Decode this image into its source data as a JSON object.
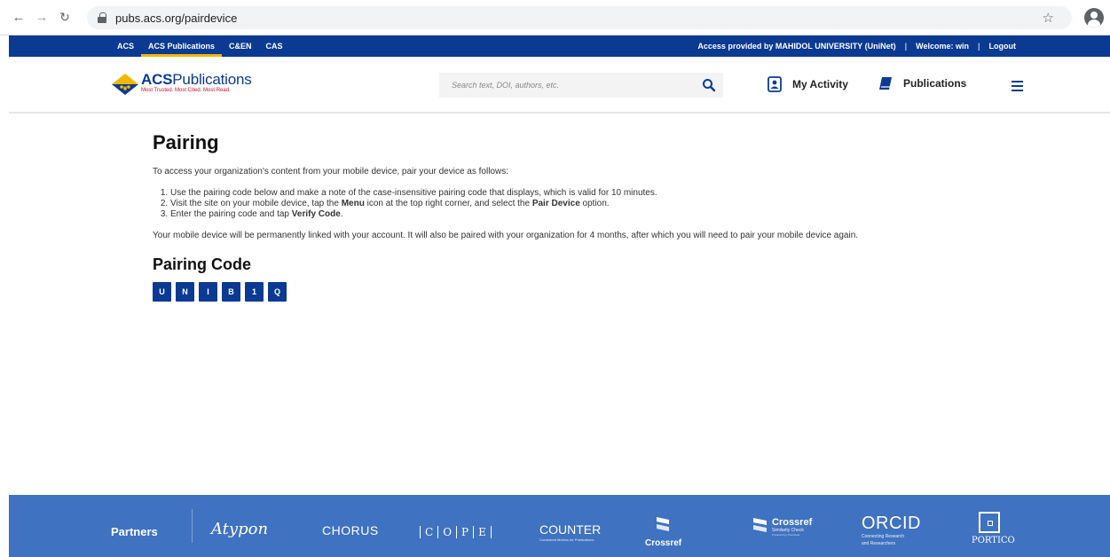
{
  "browser": {
    "url": "pubs.acs.org/pairdevice",
    "back_icon": "arrow-left-icon",
    "forward_icon": "arrow-right-icon",
    "reload_icon": "reload-icon"
  },
  "utility_bar": {
    "links": [
      "ACS",
      "ACS Publications",
      "C&EN",
      "CAS"
    ],
    "active_link": "ACS Publications",
    "access_text": "Access provided by MAHIDOL UNIVERSITY (UniNet)",
    "welcome_text": "Welcome: win",
    "logout_label": "Logout"
  },
  "header": {
    "logo_name_bold": "ACS",
    "logo_name_rest": "Publications",
    "logo_tagline": "Most Trusted. Most Cited. Most Read.",
    "search_placeholder": "Search text, DOI, authors, etc.",
    "my_activity_label": "My Activity",
    "publications_label": "Publications"
  },
  "content": {
    "title": "Pairing",
    "intro": "To access your organization's content from your mobile device, pair your device as follows:",
    "steps": [
      {
        "text_before": "Use the pairing code below and make a note of the case-insensitive pairing code that displays, which is valid for 10 minutes."
      },
      {
        "text_before": "Visit the site on your mobile device, tap the ",
        "bold1": "Menu",
        "text_mid": " icon at the top right corner, and select the ",
        "bold2": "Pair Device",
        "text_after": " option."
      },
      {
        "text_before": "Enter the pairing code and tap ",
        "bold1": "Verify Code",
        "text_mid": "."
      }
    ],
    "note": "Your mobile device will be permanently linked with your account. It will also be paired with your organization for 4 months, after which you will need to pair your mobile device again.",
    "code_title": "Pairing Code",
    "code_chars": [
      "U",
      "N",
      "I",
      "B",
      "1",
      "Q"
    ]
  },
  "footer": {
    "partners_label": "Partners",
    "atypon": "Atypon",
    "chorus": "CHORUS",
    "cope": [
      "C",
      "O",
      "P",
      "E"
    ],
    "counter": "COUNTER",
    "counter_sub": "Consistent Metrics for Publications",
    "crossref": "Crossref",
    "crossref_sim": "Crossref",
    "crossref_sim_sub": "Similarity Check",
    "crossref_sim_sub2": "Powered by iThenticate",
    "orcid": "ORCID",
    "orcid_sub1": "Connecting Research",
    "orcid_sub2": "and Researchers",
    "portico": "PORTICO"
  },
  "colors": {
    "acs_blue": "#0b3a92",
    "footer_blue": "#3f72c0",
    "accent_gold": "#f2b705",
    "logo_red": "#c8102e"
  }
}
